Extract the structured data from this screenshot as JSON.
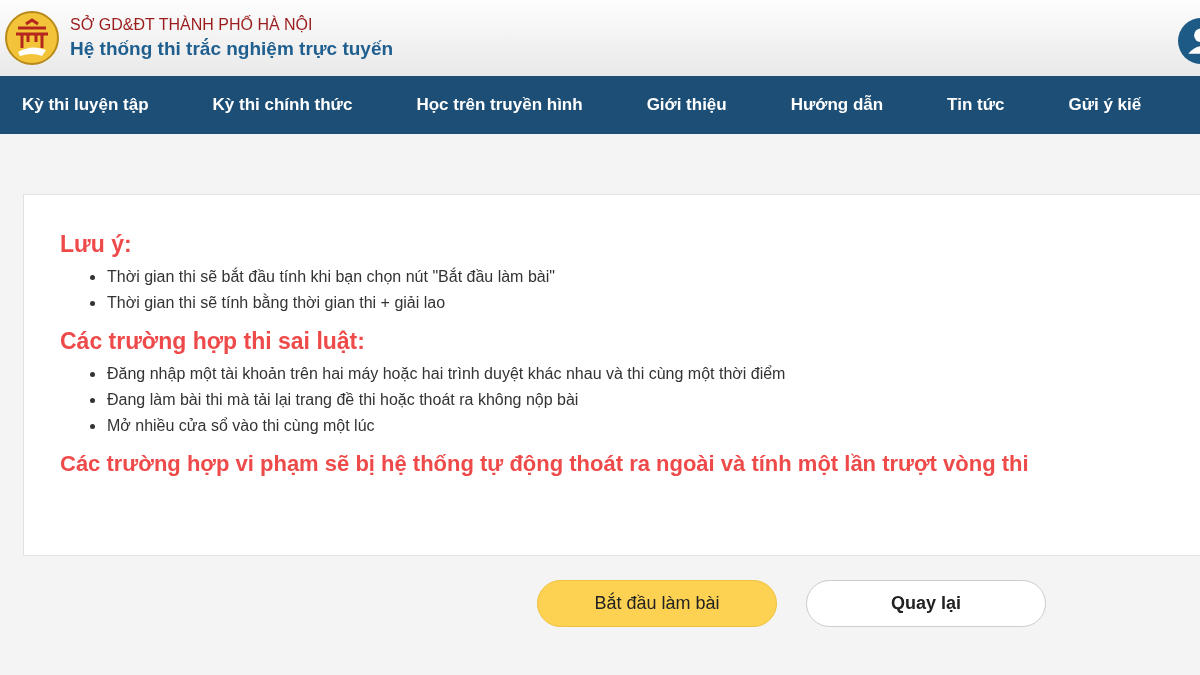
{
  "header": {
    "org": "SỞ GD&ĐT THÀNH PHỐ HÀ NỘI",
    "title": "Hệ thống thi trắc nghiệm trực tuyến"
  },
  "nav": [
    {
      "label": "Kỳ thi luyện tập"
    },
    {
      "label": "Kỳ thi chính thức"
    },
    {
      "label": "Học trên truyền hình"
    },
    {
      "label": "Giới thiệu"
    },
    {
      "label": "Hướng dẫn"
    },
    {
      "label": "Tin tức"
    },
    {
      "label": "Gửi ý kiế"
    }
  ],
  "notice": {
    "sections": [
      {
        "heading": "Lưu ý:",
        "items": [
          "Thời gian thi sẽ bắt đầu tính khi bạn chọn nút \"Bắt đầu làm bài\"",
          "Thời gian thi sẽ tính bằng thời gian thi + giải lao"
        ]
      },
      {
        "heading": "Các trường hợp thi sai luật:",
        "items": [
          "Đăng nhập một tài khoản trên hai máy hoặc hai trình duyệt khác nhau và thi cùng một thời điểm",
          "Đang làm bài thi mà tải lại trang đề thi hoặc thoát ra không nộp bài",
          "Mở nhiều cửa sổ vào thi cùng một lúc"
        ]
      }
    ],
    "warning": "Các trường hợp vi phạm sẽ bị hệ thống tự động thoát ra ngoài và tính một lần trượt vòng thi"
  },
  "buttons": [
    {
      "kind": "primary",
      "label": "Bắt đầu làm bài"
    },
    {
      "kind": "secondary",
      "label": "Quay lại"
    }
  ]
}
